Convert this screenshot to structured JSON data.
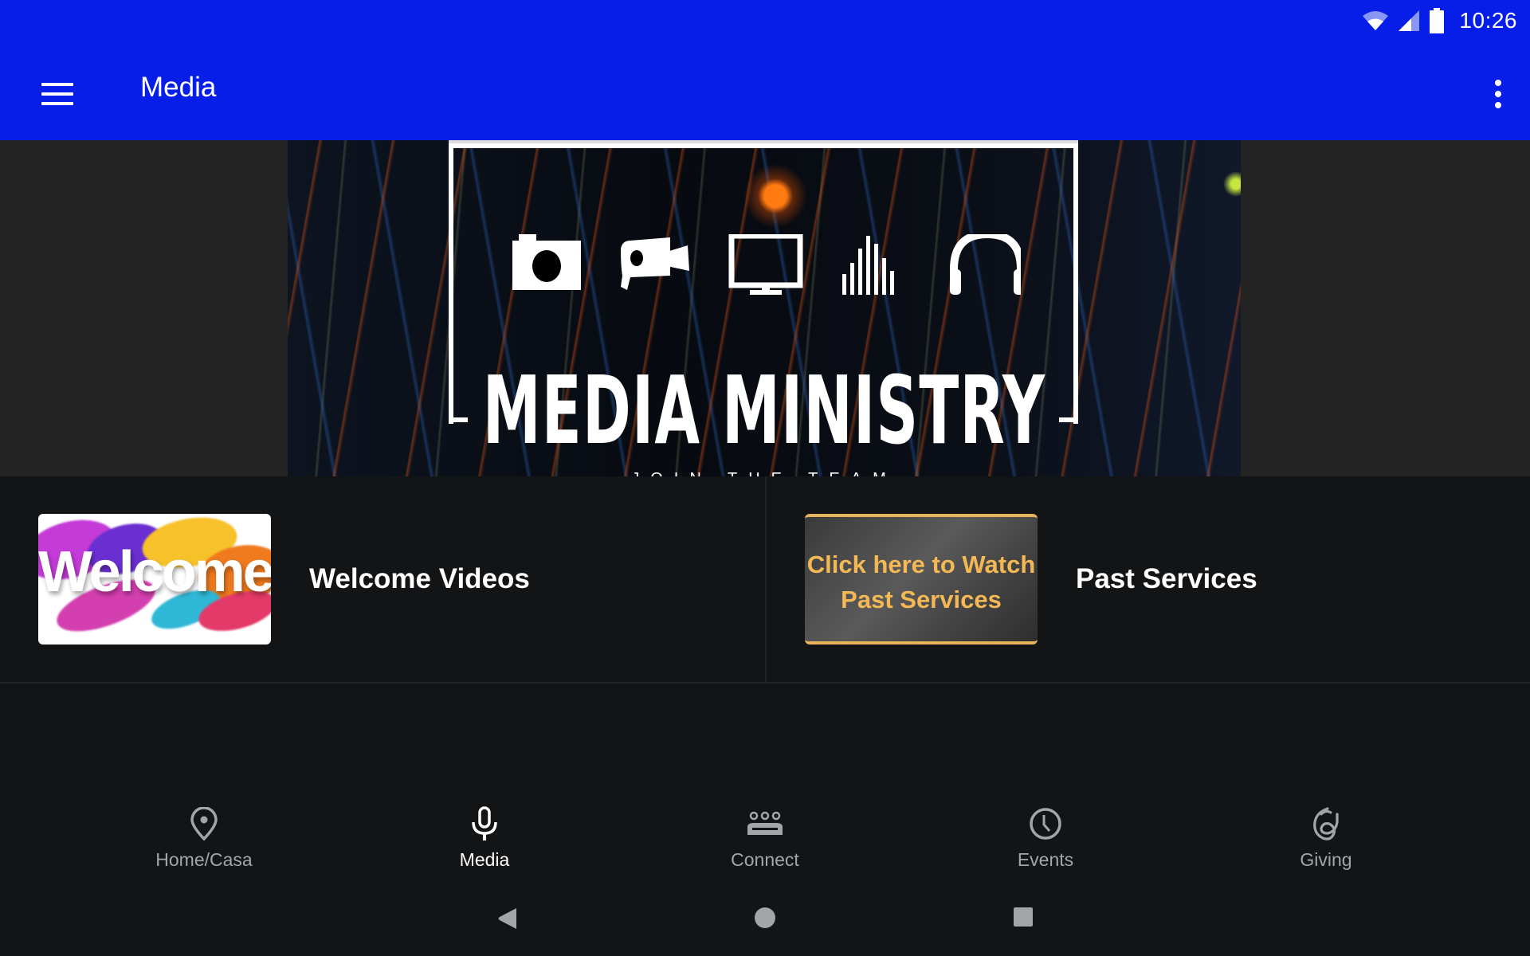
{
  "status_bar": {
    "time": "10:26",
    "icons": [
      "wifi-icon",
      "cell-signal-icon",
      "battery-icon"
    ]
  },
  "app_bar": {
    "title": "Media",
    "menu_icon": "hamburger-menu-icon",
    "overflow_icon": "more-vertical-icon"
  },
  "banner": {
    "title": "MEDIA MINISTRY",
    "subtitle": "JOIN THE TEAM",
    "icons": [
      "camera-icon",
      "video-camera-icon",
      "monitor-icon",
      "audio-levels-icon",
      "headphones-icon"
    ]
  },
  "cards": [
    {
      "label": "Welcome Videos",
      "thumbnail_text": "Welcome"
    },
    {
      "label": "Past Services",
      "thumbnail_text_line1": "Click here to Watch",
      "thumbnail_text_line2": "Past Services"
    }
  ],
  "bottom_nav": {
    "active": "Media",
    "items": [
      {
        "label": "Home/Casa",
        "icon": "map-pin-icon"
      },
      {
        "label": "Media",
        "icon": "microphone-icon"
      },
      {
        "label": "Connect",
        "icon": "group-icon"
      },
      {
        "label": "Events",
        "icon": "clock-icon"
      },
      {
        "label": "Giving",
        "icon": "giving-hand-icon"
      }
    ]
  },
  "system_nav": [
    "back-icon",
    "home-icon",
    "recents-icon"
  ],
  "colors": {
    "app_bar": "#061ee8",
    "background": "#131416",
    "nav_inactive": "#a3a6a8",
    "past_services_accent": "#f4b955"
  }
}
